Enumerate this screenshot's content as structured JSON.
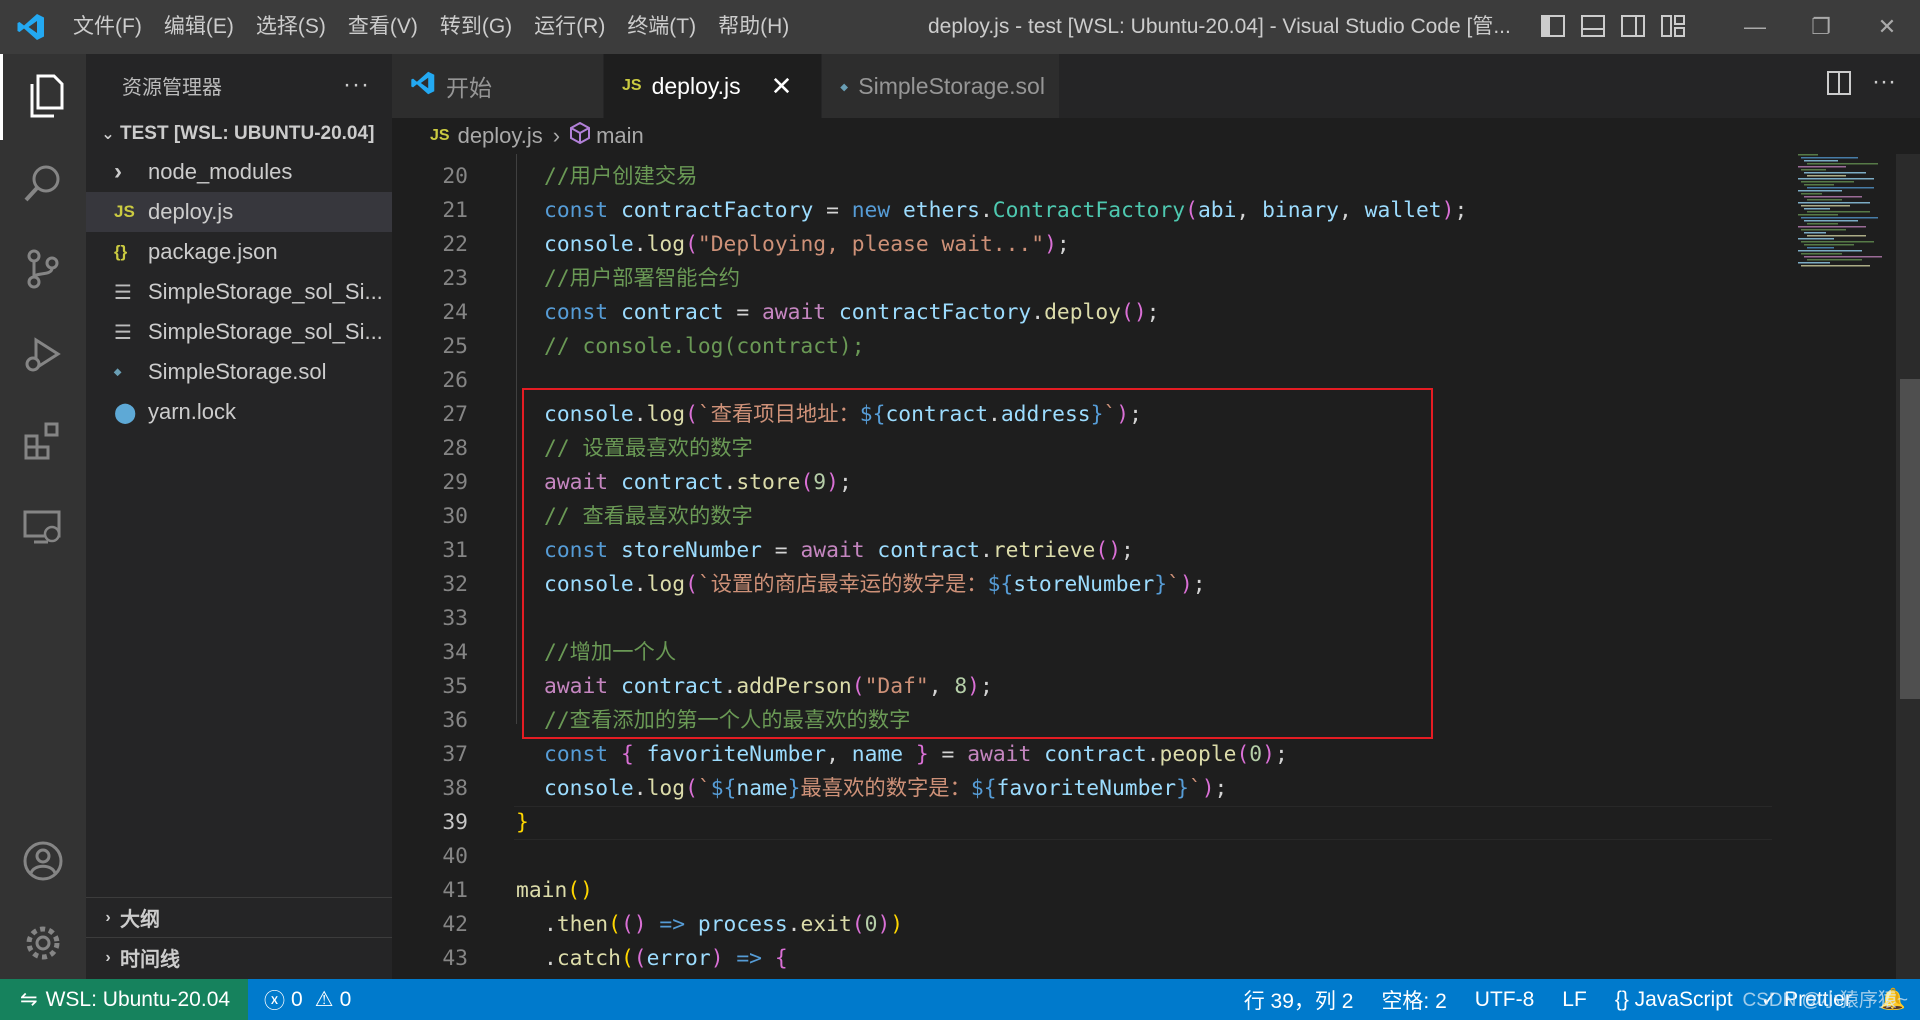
{
  "titlebar": {
    "menus": [
      "文件(F)",
      "编辑(E)",
      "选择(S)",
      "查看(V)",
      "转到(G)",
      "运行(R)",
      "终端(T)",
      "帮助(H)"
    ],
    "window_title": "deploy.js - test [WSL: Ubuntu-20.04] - Visual Studio Code [管..."
  },
  "sidebar": {
    "title": "资源管理器",
    "more": "···",
    "workspace": "TEST [WSL: UBUNTU-20.04]",
    "items": [
      {
        "label": "node_modules",
        "icon": "chevron-right-icon"
      },
      {
        "label": "deploy.js",
        "icon": "js-file-icon",
        "badge": "JS"
      },
      {
        "label": "package.json",
        "icon": "json-file-icon",
        "badge": "{}"
      },
      {
        "label": "SimpleStorage_sol_Si...",
        "icon": "text-file-icon"
      },
      {
        "label": "SimpleStorage_sol_Si...",
        "icon": "text-file-icon"
      },
      {
        "label": "SimpleStorage.sol",
        "icon": "solidity-file-icon"
      },
      {
        "label": "yarn.lock",
        "icon": "yarn-file-icon"
      }
    ],
    "outline_label": "大纲",
    "timeline_label": "时间线"
  },
  "tabs": [
    {
      "label": "开始",
      "icon": "vscode-icon"
    },
    {
      "label": "deploy.js",
      "badge": "JS",
      "close": "✕"
    },
    {
      "label": "SimpleStorage.sol",
      "icon": "solidity-file-icon"
    }
  ],
  "breadcrumb": {
    "file": "deploy.js",
    "file_badge": "JS",
    "symbol": "main"
  },
  "code": {
    "lines": [
      {
        "n": "20",
        "t": [
          [
            "cmt",
            "//用户创建交易"
          ]
        ]
      },
      {
        "n": "21",
        "t": [
          [
            "kw",
            "const "
          ],
          [
            "vr",
            "contractFactory"
          ],
          [
            "pl",
            " = "
          ],
          [
            "kw",
            "new "
          ],
          [
            "vr",
            "ethers"
          ],
          [
            "pl",
            "."
          ],
          [
            "cls",
            "ContractFactory"
          ],
          [
            "b2",
            "("
          ],
          [
            "vr",
            "abi"
          ],
          [
            "pl",
            ", "
          ],
          [
            "vr",
            "binary"
          ],
          [
            "pl",
            ", "
          ],
          [
            "vr",
            "wallet"
          ],
          [
            "b2",
            ")"
          ],
          [
            "pl",
            ";"
          ]
        ]
      },
      {
        "n": "22",
        "t": [
          [
            "vr",
            "console"
          ],
          [
            "pl",
            "."
          ],
          [
            "fn",
            "log"
          ],
          [
            "b2",
            "("
          ],
          [
            "str",
            "\"Deploying, please wait...\""
          ],
          [
            "b2",
            ")"
          ],
          [
            "pl",
            ";"
          ]
        ]
      },
      {
        "n": "23",
        "t": [
          [
            "cmt",
            "//用户部署智能合约"
          ]
        ]
      },
      {
        "n": "24",
        "t": [
          [
            "kw",
            "const "
          ],
          [
            "vr",
            "contract"
          ],
          [
            "pl",
            " = "
          ],
          [
            "kw2",
            "await "
          ],
          [
            "vr",
            "contractFactory"
          ],
          [
            "pl",
            "."
          ],
          [
            "fn",
            "deploy"
          ],
          [
            "b2",
            "()"
          ],
          [
            "pl",
            ";"
          ]
        ]
      },
      {
        "n": "25",
        "t": [
          [
            "cmt",
            "// console.log(contract);"
          ]
        ]
      },
      {
        "n": "26",
        "t": []
      },
      {
        "n": "27",
        "t": [
          [
            "vr",
            "console"
          ],
          [
            "pl",
            "."
          ],
          [
            "fn",
            "log"
          ],
          [
            "b2",
            "("
          ],
          [
            "str",
            "`查看项目地址："
          ],
          [
            "kw",
            "${"
          ],
          [
            "vr",
            "contract"
          ],
          [
            "pl",
            "."
          ],
          [
            "vr",
            "address"
          ],
          [
            "kw",
            "}"
          ],
          [
            "str",
            "`"
          ],
          [
            "b2",
            ")"
          ],
          [
            "pl",
            ";"
          ]
        ]
      },
      {
        "n": "28",
        "t": [
          [
            "cmt",
            "// 设置最喜欢的数字"
          ]
        ]
      },
      {
        "n": "29",
        "t": [
          [
            "kw2",
            "await "
          ],
          [
            "vr",
            "contract"
          ],
          [
            "pl",
            "."
          ],
          [
            "fn",
            "store"
          ],
          [
            "b2",
            "("
          ],
          [
            "num",
            "9"
          ],
          [
            "b2",
            ")"
          ],
          [
            "pl",
            ";"
          ]
        ]
      },
      {
        "n": "30",
        "t": [
          [
            "cmt",
            "// 查看最喜欢的数字"
          ]
        ]
      },
      {
        "n": "31",
        "t": [
          [
            "kw",
            "const "
          ],
          [
            "vr",
            "storeNumber"
          ],
          [
            "pl",
            " = "
          ],
          [
            "kw2",
            "await "
          ],
          [
            "vr",
            "contract"
          ],
          [
            "pl",
            "."
          ],
          [
            "fn",
            "retrieve"
          ],
          [
            "b2",
            "()"
          ],
          [
            "pl",
            ";"
          ]
        ]
      },
      {
        "n": "32",
        "t": [
          [
            "vr",
            "console"
          ],
          [
            "pl",
            "."
          ],
          [
            "fn",
            "log"
          ],
          [
            "b2",
            "("
          ],
          [
            "str",
            "`设置的商店最幸运的数字是："
          ],
          [
            "kw",
            "${"
          ],
          [
            "vr",
            "storeNumber"
          ],
          [
            "kw",
            "}"
          ],
          [
            "str",
            "`"
          ],
          [
            "b2",
            ")"
          ],
          [
            "pl",
            ";"
          ]
        ]
      },
      {
        "n": "33",
        "t": []
      },
      {
        "n": "34",
        "t": [
          [
            "cmt",
            "//增加一个人"
          ]
        ]
      },
      {
        "n": "35",
        "t": [
          [
            "kw2",
            "await "
          ],
          [
            "vr",
            "contract"
          ],
          [
            "pl",
            "."
          ],
          [
            "fn",
            "addPerson"
          ],
          [
            "b2",
            "("
          ],
          [
            "str",
            "\"Daf\""
          ],
          [
            "pl",
            ", "
          ],
          [
            "num",
            "8"
          ],
          [
            "b2",
            ")"
          ],
          [
            "pl",
            ";"
          ]
        ]
      },
      {
        "n": "36",
        "t": [
          [
            "cmt",
            "//查看添加的第一个人的最喜欢的数字"
          ]
        ]
      },
      {
        "n": "37",
        "t": [
          [
            "kw",
            "const "
          ],
          [
            "b2",
            "{ "
          ],
          [
            "vr",
            "favoriteNumber"
          ],
          [
            "pl",
            ", "
          ],
          [
            "vr",
            "name"
          ],
          [
            "b2",
            " }"
          ],
          [
            "pl",
            " = "
          ],
          [
            "kw2",
            "await "
          ],
          [
            "vr",
            "contract"
          ],
          [
            "pl",
            "."
          ],
          [
            "fn",
            "people"
          ],
          [
            "b2",
            "("
          ],
          [
            "num",
            "0"
          ],
          [
            "b2",
            ")"
          ],
          [
            "pl",
            ";"
          ]
        ]
      },
      {
        "n": "38",
        "t": [
          [
            "vr",
            "console"
          ],
          [
            "pl",
            "."
          ],
          [
            "fn",
            "log"
          ],
          [
            "b2",
            "("
          ],
          [
            "str",
            "`"
          ],
          [
            "kw",
            "${"
          ],
          [
            "vr",
            "name"
          ],
          [
            "kw",
            "}"
          ],
          [
            "str",
            "最喜欢的数字是："
          ],
          [
            "kw",
            "${"
          ],
          [
            "vr",
            "favoriteNumber"
          ],
          [
            "kw",
            "}"
          ],
          [
            "str",
            "`"
          ],
          [
            "b2",
            ")"
          ],
          [
            "pl",
            ";"
          ]
        ]
      },
      {
        "n": "39",
        "t": [
          [
            "b1",
            "}"
          ]
        ],
        "current": true,
        "outdent": true
      },
      {
        "n": "40",
        "t": []
      },
      {
        "n": "41",
        "t": [
          [
            "fn",
            "main"
          ],
          [
            "b1",
            "()"
          ]
        ],
        "outdent": true
      },
      {
        "n": "42",
        "t": [
          [
            "pl",
            "."
          ],
          [
            "fn",
            "then"
          ],
          [
            "b1",
            "("
          ],
          [
            "b2",
            "()"
          ],
          [
            "kw",
            " => "
          ],
          [
            "vr",
            "process"
          ],
          [
            "pl",
            "."
          ],
          [
            "fn",
            "exit"
          ],
          [
            "b2",
            "("
          ],
          [
            "num",
            "0"
          ],
          [
            "b2",
            ")"
          ],
          [
            "b1",
            ")"
          ]
        ]
      },
      {
        "n": "43",
        "t": [
          [
            "pl",
            "."
          ],
          [
            "fn",
            "catch"
          ],
          [
            "b1",
            "("
          ],
          [
            "b2",
            "("
          ],
          [
            "vr",
            "error"
          ],
          [
            "b2",
            ")"
          ],
          [
            "kw",
            " => "
          ],
          [
            "b2",
            "{"
          ]
        ]
      }
    ]
  },
  "statusbar": {
    "remote": "WSL: Ubuntu-20.04",
    "errors": "0",
    "warnings": "0",
    "position": "行 39，列 2",
    "spaces": "空格: 2",
    "encoding": "UTF-8",
    "eol": "LF",
    "language": "{} JavaScript",
    "prettier": "✓ Prettier",
    "watermark": "CSDN @小猿序猿~"
  },
  "colors": {
    "accent": "#007acc",
    "remote": "#16825d",
    "highlight_box": "#e51c23"
  }
}
